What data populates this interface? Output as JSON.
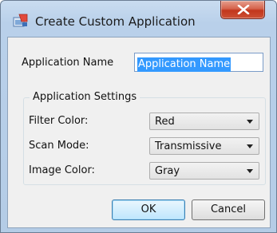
{
  "window": {
    "title": "Create Custom Application",
    "icons": {
      "app": "application-icon",
      "close": "close-icon"
    }
  },
  "form": {
    "name_label": "Application Name",
    "name_value": "Application Name"
  },
  "settings": {
    "group_title": "Application Settings",
    "filter_color": {
      "label": "Filter Color:",
      "value": "Red"
    },
    "scan_mode": {
      "label": "Scan Mode:",
      "value": "Transmissive"
    },
    "image_color": {
      "label": "Image Color:",
      "value": "Gray"
    }
  },
  "buttons": {
    "ok": "OK",
    "cancel": "Cancel"
  },
  "colors": {
    "close_button": "#c8422a",
    "selection": "#3399ff",
    "dialog_bg": "#f0f0f0"
  }
}
